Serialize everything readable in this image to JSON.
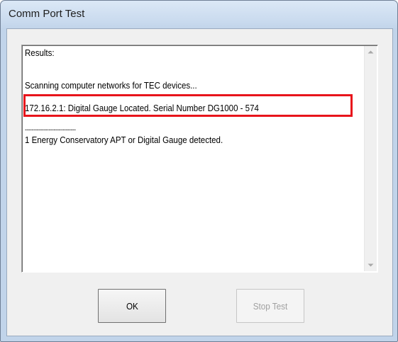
{
  "window": {
    "title": "Comm Port Test"
  },
  "results": {
    "lines": [
      "Results:",
      "Scanning computer networks for TEC devices...",
      "172.16.2.1:  Digital Gauge Located. Serial Number DG1000 - 574",
      "------------------------------",
      "1 Energy Conservatory APT or Digital Gauge detected."
    ]
  },
  "buttons": {
    "ok_label": "OK",
    "stop_label": "Stop Test"
  },
  "colors": {
    "highlight_border": "#e8141b",
    "disabled_text": "#a0a0a0"
  }
}
